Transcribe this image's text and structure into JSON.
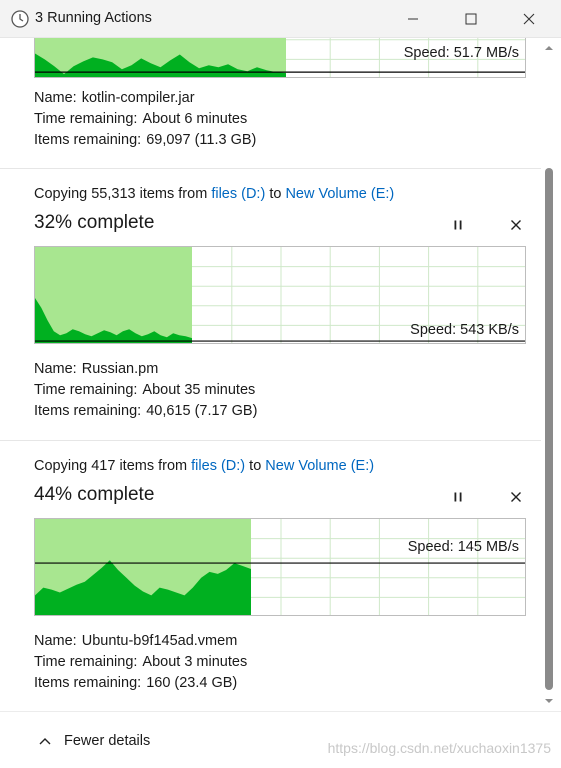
{
  "window": {
    "title": "3 Running Actions",
    "icon": "clock-icon"
  },
  "colors": {
    "fill_light": "#a8e690",
    "fill_dark": "#00b020",
    "grid": "#cfe8c9",
    "link": "#0067c0"
  },
  "operations": [
    {
      "speed": "Speed: 51.7 MB/s",
      "name_label": "Name:",
      "name": "kotlin-compiler.jar",
      "time_label": "Time remaining:",
      "time": "About 6 minutes",
      "items_label": "Items remaining:",
      "items": "69,097 (11.3 GB)",
      "progress": 0.51
    },
    {
      "copy_prefix": "Copying 55,313 items from",
      "source": "files (D:)",
      "to_word": "to",
      "destination": "New Volume (E:)",
      "percent_text": "32% complete",
      "progress": 0.32,
      "speed": "Speed: 543 KB/s",
      "name_label": "Name:",
      "name": "Russian.pm",
      "time_label": "Time remaining:",
      "time": "About 35 minutes",
      "items_label": "Items remaining:",
      "items": "40,615 (7.17 GB)"
    },
    {
      "copy_prefix": "Copying 417 items from",
      "source": "files (D:)",
      "to_word": "to",
      "destination": "New Volume (E:)",
      "percent_text": "44% complete",
      "progress": 0.44,
      "speed": "Speed: 145 MB/s",
      "name_label": "Name:",
      "name": "Ubuntu-b9f145ad.vmem",
      "time_label": "Time remaining:",
      "time": "About 3 minutes",
      "items_label": "Items remaining:",
      "items": "160 (23.4 GB)"
    }
  ],
  "footer": {
    "fewer_details": "Fewer details",
    "watermark": "https://blog.csdn.net/xuchaoxin1375"
  }
}
